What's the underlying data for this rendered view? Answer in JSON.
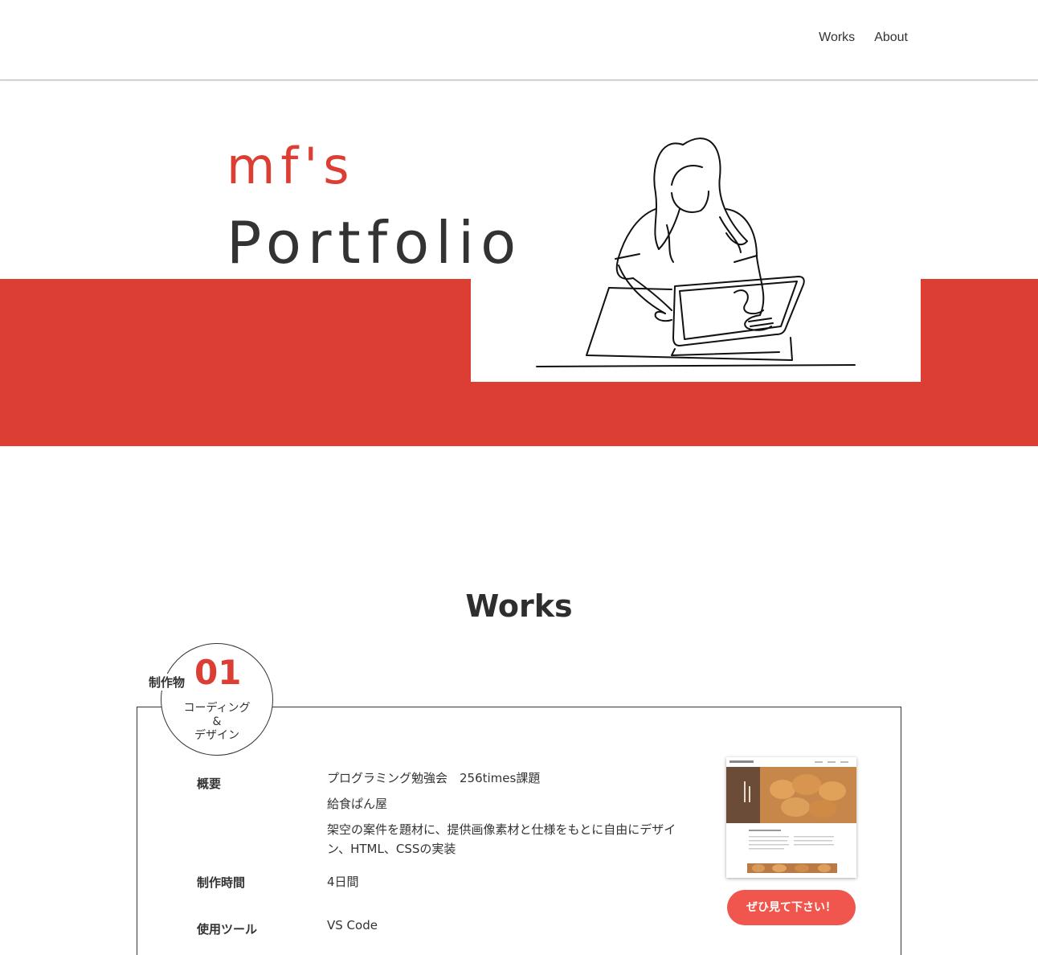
{
  "nav": {
    "items": [
      {
        "label": "Works"
      },
      {
        "label": "About"
      }
    ]
  },
  "hero": {
    "title_line1": "mf's",
    "title_line2": "Portfolio"
  },
  "works": {
    "heading": "Works",
    "items": [
      {
        "badge_label": "制作物",
        "badge_number": "01",
        "badge_type_line1": "コーディング",
        "badge_type_line2": "&",
        "badge_type_line3": "デザイン",
        "overview_label": "概要",
        "overview_lines": [
          "プログラミング勉強会　256times課題",
          "給食ぱん屋",
          "架空の案件を題材に、提供画像素材と仕様をもとに自由にデザイン、HTML、CSSの実装"
        ],
        "time_label": "制作時間",
        "time_value": "4日間",
        "tools_label": "使用ツール",
        "tools_value": "VS Code",
        "button_label": "ぜひ見て下さい！"
      }
    ]
  },
  "colors": {
    "accent": "#dc3e34",
    "button": "#f0564d",
    "text": "#333333"
  }
}
